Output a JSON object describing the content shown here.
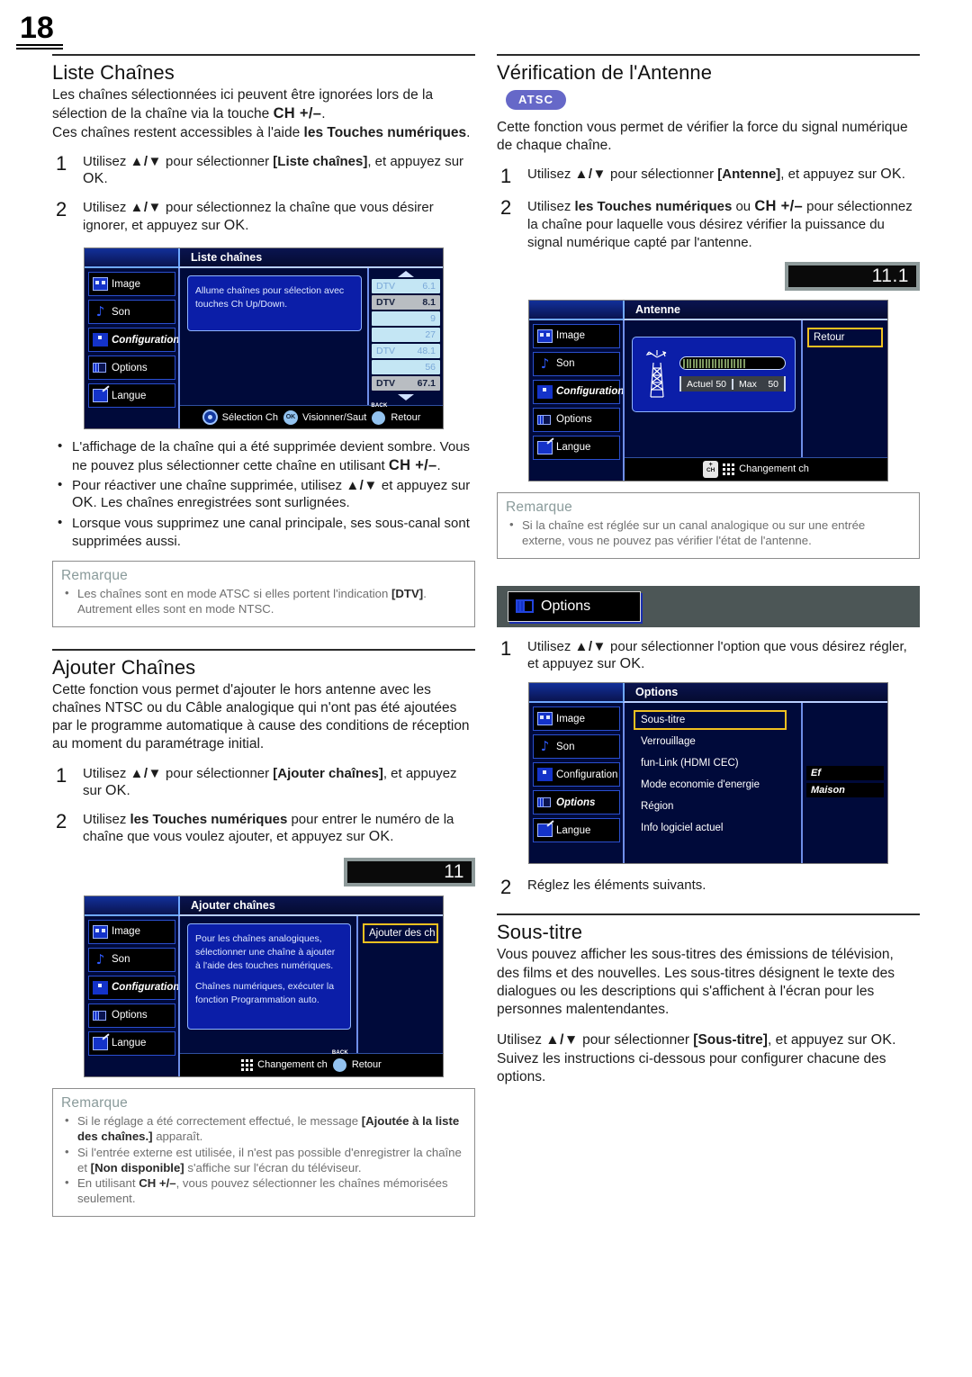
{
  "page": {
    "number": "18"
  },
  "left_column": {
    "section1": {
      "title": "Liste Chaînes",
      "intro_1": "Les chaînes sélectionnées ici peuvent être ignorées lors de la sélection de la chaîne via la touche ",
      "intro_1_b": "CH +/–",
      "intro_1_end": ".",
      "intro_2": "Ces chaînes restent accessibles à l'aide ",
      "intro_2_b": "les Touches numériques",
      "intro_2_end": ".",
      "step1_num": "1",
      "step1_a": "Utilisez ",
      "step1_arrows": "▲/▼",
      "step1_b": " pour sélectionner ",
      "step1_bold": "[Liste chaînes]",
      "step1_c": ", et appuyez sur ",
      "step1_ok": "OK",
      "step1_d": ".",
      "step2_num": "2",
      "step2_a": "Utilisez ",
      "step2_arrows": "▲/▼",
      "step2_b": " pour sélectionnez la chaîne que vous désirer ignorer, et appuyez sur ",
      "step2_ok": "OK",
      "step2_c": ".",
      "bullets": [
        {
          "a": "L'affichage de la chaîne qui a été supprimée devient sombre. Vous ne pouvez plus sélectionner cette chaîne en utilisant ",
          "b": "CH +/–",
          "c": "."
        },
        {
          "a": "Pour réactiver une chaîne supprimée, utilisez ",
          "b": "▲/▼",
          "c": " et appuyez sur ",
          "d": "OK",
          "e": ". Les chaînes enregistrées sont surlignées."
        },
        {
          "a": "Lorsque vous supprimez une canal principale, ses sous-canal sont supprimées aussi."
        }
      ],
      "remarque_title": "Remarque",
      "remarque_items": [
        {
          "a": "Les chaînes sont en mode ATSC si elles portent l'indication ",
          "b": "[DTV]",
          "c": ". Autrement elles sont en mode NTSC."
        }
      ]
    },
    "tv_liste": {
      "header_title": "Liste chaînes",
      "sidebar": [
        "Image",
        "Son",
        "Configuration",
        "Options",
        "Langue"
      ],
      "note_line1": "Allume chaînes pour sélection avec",
      "note_line2": "touches Ch Up/Down.",
      "channels": [
        {
          "tag": "DTV",
          "num": "6.1",
          "style": "pale"
        },
        {
          "tag": "DTV",
          "num": "8.1",
          "style": "grey"
        },
        {
          "tag": "",
          "num": "9",
          "style": "pale"
        },
        {
          "tag": "",
          "num": "27",
          "style": "pale"
        },
        {
          "tag": "DTV",
          "num": "48.1",
          "style": "pale"
        },
        {
          "tag": "",
          "num": "56",
          "style": "pale"
        },
        {
          "tag": "DTV",
          "num": "67.1",
          "style": "grey"
        }
      ],
      "footer_nav": "Sélection Ch",
      "footer_ok_key": "OK",
      "footer_ok": "Visionner/Saut",
      "footer_back_key": "BACK",
      "footer_back": "Retour"
    },
    "section2": {
      "title": "Ajouter Chaînes",
      "intro": "Cette fonction vous permet d'ajouter le hors antenne avec les chaînes NTSC ou du Câble analogique qui n'ont pas été ajoutées par le programme automatique à cause des conditions de réception au moment du paramétrage initial.",
      "step1_num": "1",
      "step1_a": "Utilisez ",
      "step1_arrows": "▲/▼",
      "step1_b": " pour sélectionner ",
      "step1_bold": "[Ajouter chaînes]",
      "step1_c": ", et appuyez sur ",
      "step1_ok": "OK",
      "step1_d": ".",
      "step2_num": "2",
      "step2_a": "Utilisez ",
      "step2_bold": "les Touches numériques",
      "step2_b": " pour entrer le numéro de la chaîne que vous voulez ajouter, et appuyez sur ",
      "step2_ok": "OK",
      "step2_c": ".",
      "channel_badge": "11"
    },
    "tv_ajouter": {
      "header_title": "Ajouter chaînes",
      "sidebar": [
        "Image",
        "Son",
        "Configuration",
        "Options",
        "Langue"
      ],
      "note_p1": "Pour les chaînes analogiques, sélectionner une chaîne à ajouter à l'aide des touches numériques.",
      "note_p2": "Chaînes numériques, exécuter la fonction Programmation auto.",
      "right_button": "Ajouter des ch",
      "footer_keypad": "Changement ch",
      "footer_back_key": "BACK",
      "footer_back": "Retour"
    },
    "remarque2": {
      "title": "Remarque",
      "items": [
        {
          "a": "Si le réglage a été correctement effectué, le message ",
          "b": "[Ajoutée à la liste des chaînes.]",
          "c": " apparaît."
        },
        {
          "a": "Si l'entrée externe est utilisée, il n'est pas possible d'enregistrer la chaîne et ",
          "b": "[Non disponible]",
          "c": " s'affiche sur l'écran du téléviseur."
        },
        {
          "a": "En utilisant ",
          "b": "CH +/–",
          "c": ", vous pouvez sélectionner les chaînes mémorisées seulement."
        }
      ]
    }
  },
  "right_column": {
    "section1": {
      "title": "Vérification de l'Antenne",
      "badge": "ATSC",
      "intro": "Cette fonction vous permet de vérifier la force du signal numérique de chaque chaîne.",
      "step1_num": "1",
      "step1_a": "Utilisez ",
      "step1_arrows": "▲/▼",
      "step1_b": " pour sélectionner ",
      "step1_bold": "[Antenne]",
      "step1_c": ", et appuyez sur ",
      "step1_ok": "OK",
      "step1_d": ".",
      "step2_num": "2",
      "step2_a": "Utilisez ",
      "step2_bold": "les Touches numériques",
      "step2_b": " ou ",
      "step2_ch": "CH +/–",
      "step2_c": " pour sélectionnez la chaîne pour laquelle vous désirez vérifier la puissance du signal numérique capté par l'antenne.",
      "channel_badge": "11.1"
    },
    "tv_antenne": {
      "header_title": "Antenne",
      "sidebar": [
        "Image",
        "Son",
        "Configuration",
        "Options",
        "Langue"
      ],
      "right_button": "Retour",
      "meter_fill_percent": 50,
      "readout_label_current": "Actuel",
      "readout_value_current": "50",
      "readout_label_max": "Max",
      "readout_value_max": "50",
      "footer_ch_key": "CH",
      "footer_text": "Changement ch"
    },
    "remarque1": {
      "title": "Remarque",
      "items": [
        {
          "a": "Si la chaîne est réglée sur un canal analogique ou sur une entrée externe, vous ne pouvez pas vérifier l'état de l'antenne."
        }
      ]
    },
    "options_banner": {
      "label": "Options"
    },
    "options_steps": {
      "step1_num": "1",
      "step1_a": "Utilisez ",
      "step1_arrows": "▲/▼",
      "step1_b": " pour sélectionner l'option que vous désirez régler, et appuyez sur ",
      "step1_ok": "OK",
      "step1_c": ".",
      "step2_num": "2",
      "step2_text": "Réglez les éléments suivants."
    },
    "tv_options": {
      "header_title": "Options",
      "sidebar": [
        "Image",
        "Son",
        "Configuration",
        "Options",
        "Langue"
      ],
      "rows": [
        "Sous-titre",
        "Verrouillage",
        "fun-Link (HDMI CEC)",
        "Mode economie d'energie",
        "Région",
        "Info logiciel actuel"
      ],
      "selected_row": "Sous-titre",
      "values": [
        "Ef",
        "Maison"
      ]
    },
    "section2": {
      "title": "Sous-titre",
      "intro": "Vous pouvez afficher les sous-titres des émissions de télévision, des films et des nouvelles. Les sous-titres désignent le texte des dialogues ou les descriptions qui s'affichent à l'écran pour les personnes malentendantes.",
      "use_a": "Utilisez ",
      "use_arrows": "▲/▼",
      "use_b": " pour sélectionner ",
      "use_bold": "[Sous-titre]",
      "use_c": ", et appuyez sur ",
      "use_ok": "OK",
      "use_d": ".",
      "follow": "Suivez les instructions ci-dessous pour configurer chacune des options."
    }
  },
  "colors": {
    "atsc_badge": "#6668c8",
    "osd_blue": "#000a3a",
    "osd_panel": "#0b1ea8",
    "highlight_yellow": "#f0c020",
    "note_grey": "#6f6f6f"
  }
}
